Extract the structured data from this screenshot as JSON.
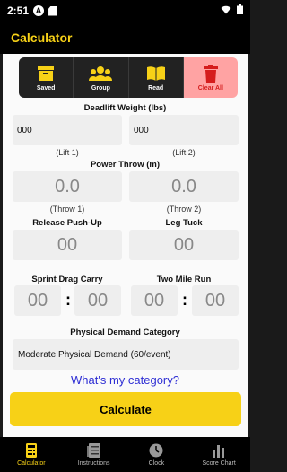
{
  "status_bar": {
    "time": "2:51",
    "a_icon_label": "A"
  },
  "app_bar": {
    "title": "Calculator"
  },
  "toolbar": {
    "saved_label": "Saved",
    "group_label": "Group",
    "read_label": "Read",
    "clear_label": "Clear All"
  },
  "deadlift": {
    "title": "Deadlift Weight (lbs)",
    "lift1_value": "000",
    "lift2_value": "000",
    "lift1_label": "(Lift 1)",
    "lift2_label": "(Lift 2)"
  },
  "power_throw": {
    "title": "Power Throw (m)",
    "throw1_value": "0.0",
    "throw2_value": "0.0",
    "throw1_label": "(Throw 1)",
    "throw2_label": "(Throw 2)"
  },
  "pushup": {
    "title": "Release Push-Up",
    "value": "00"
  },
  "leg_tuck": {
    "title": "Leg Tuck",
    "value": "00"
  },
  "sprint": {
    "title": "Sprint Drag Carry",
    "minutes": "00",
    "seconds": "00",
    "separator": ":"
  },
  "run": {
    "title": "Two Mile Run",
    "minutes": "00",
    "seconds": "00",
    "separator": ":"
  },
  "category": {
    "title": "Physical Demand Category",
    "selected": "Moderate Physical Demand (60/event)",
    "link_text": "What's my category?"
  },
  "calculate_label": "Calculate",
  "bottom_nav": {
    "items": [
      {
        "label": "Calculator",
        "icon": "calculator-icon",
        "active": true
      },
      {
        "label": "Instructions",
        "icon": "document-icon",
        "active": false
      },
      {
        "label": "Clock",
        "icon": "clock-icon",
        "active": false
      },
      {
        "label": "Score Chart",
        "icon": "bar-chart-icon",
        "active": false
      }
    ]
  },
  "colors": {
    "accent": "#f7d117",
    "danger_bg": "#ffa3a3",
    "danger_text": "#d51d1d",
    "link": "#2f2fd4"
  }
}
